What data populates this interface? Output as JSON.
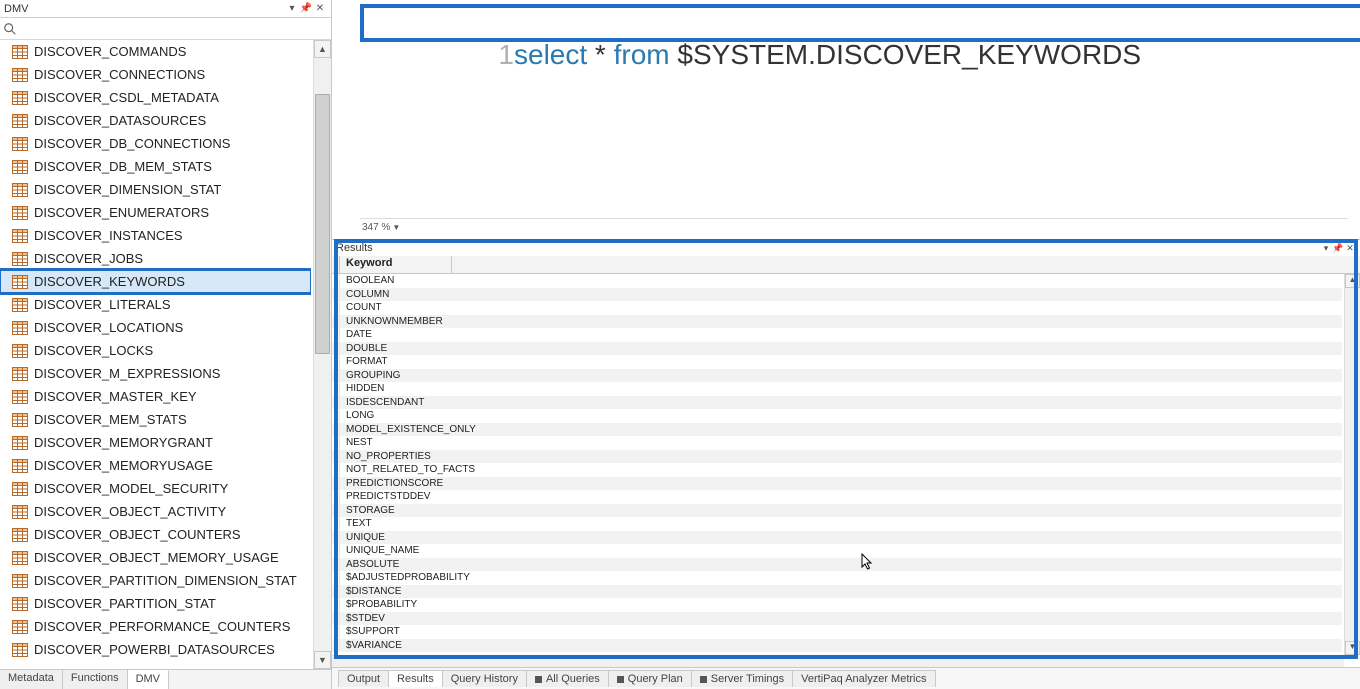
{
  "left": {
    "title": "DMV",
    "search_placeholder": "",
    "items": [
      "DISCOVER_COMMANDS",
      "DISCOVER_CONNECTIONS",
      "DISCOVER_CSDL_METADATA",
      "DISCOVER_DATASOURCES",
      "DISCOVER_DB_CONNECTIONS",
      "DISCOVER_DB_MEM_STATS",
      "DISCOVER_DIMENSION_STAT",
      "DISCOVER_ENUMERATORS",
      "DISCOVER_INSTANCES",
      "DISCOVER_JOBS",
      "DISCOVER_KEYWORDS",
      "DISCOVER_LITERALS",
      "DISCOVER_LOCATIONS",
      "DISCOVER_LOCKS",
      "DISCOVER_M_EXPRESSIONS",
      "DISCOVER_MASTER_KEY",
      "DISCOVER_MEM_STATS",
      "DISCOVER_MEMORYGRANT",
      "DISCOVER_MEMORYUSAGE",
      "DISCOVER_MODEL_SECURITY",
      "DISCOVER_OBJECT_ACTIVITY",
      "DISCOVER_OBJECT_COUNTERS",
      "DISCOVER_OBJECT_MEMORY_USAGE",
      "DISCOVER_PARTITION_DIMENSION_STAT",
      "DISCOVER_PARTITION_STAT",
      "DISCOVER_PERFORMANCE_COUNTERS",
      "DISCOVER_POWERBI_DATASOURCES"
    ],
    "selected_index": 10,
    "tabs": [
      "Metadata",
      "Functions",
      "DMV"
    ],
    "active_tab": 2
  },
  "editor": {
    "line_number": "1",
    "tok_select": "select",
    "tok_star": " * ",
    "tok_from": "from",
    "tok_rest": " $SYSTEM.DISCOVER_KEYWORDS",
    "zoom": "347 %"
  },
  "results": {
    "title": "Results",
    "column": "Keyword",
    "rows": [
      "BOOLEAN",
      "COLUMN",
      "COUNT",
      "UNKNOWNMEMBER",
      "DATE",
      "DOUBLE",
      "FORMAT",
      "GROUPING",
      "HIDDEN",
      "ISDESCENDANT",
      "LONG",
      "MODEL_EXISTENCE_ONLY",
      "NEST",
      "NO_PROPERTIES",
      "NOT_RELATED_TO_FACTS",
      "PREDICTIONSCORE",
      "PREDICTSTDDEV",
      "STORAGE",
      "TEXT",
      "UNIQUE",
      "UNIQUE_NAME",
      "ABSOLUTE",
      "$ADJUSTEDPROBABILITY",
      "$DISTANCE",
      "$PROBABILITY",
      "$STDEV",
      "$SUPPORT",
      "$VARIANCE"
    ],
    "tabs": [
      {
        "label": "Output",
        "icon": ""
      },
      {
        "label": "Results",
        "icon": ""
      },
      {
        "label": "Query History",
        "icon": ""
      },
      {
        "label": "All Queries",
        "icon": "stop"
      },
      {
        "label": "Query Plan",
        "icon": "stop"
      },
      {
        "label": "Server Timings",
        "icon": "stop"
      },
      {
        "label": "VertiPaq Analyzer Metrics",
        "icon": ""
      }
    ],
    "active_tab": 1
  }
}
